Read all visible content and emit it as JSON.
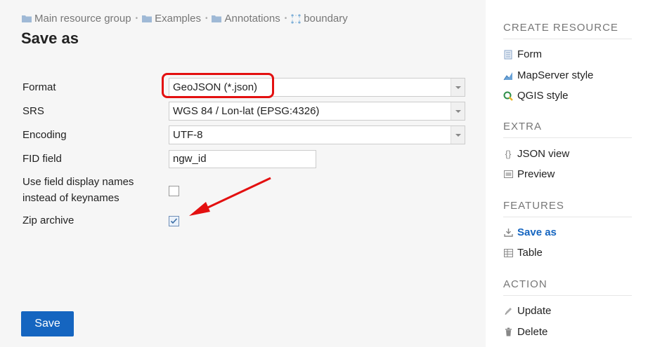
{
  "breadcrumb": {
    "items": [
      "Main resource group",
      "Examples",
      "Annotations",
      "boundary"
    ],
    "separator": "•"
  },
  "page": {
    "title": "Save as"
  },
  "form": {
    "format_label": "Format",
    "format_value": "GeoJSON (*.json)",
    "srs_label": "SRS",
    "srs_value": "WGS 84 / Lon-lat (EPSG:4326)",
    "encoding_label": "Encoding",
    "encoding_value": "UTF-8",
    "fid_label": "FID field",
    "fid_value": "ngw_id",
    "display_names_label_1": "Use field display names",
    "display_names_label_2": "instead of keynames",
    "display_names_checked": false,
    "zip_label": "Zip archive",
    "zip_checked": true,
    "save_label": "Save"
  },
  "sidebar": {
    "create_heading": "CREATE RESOURCE",
    "create_items": [
      "Form",
      "MapServer style",
      "QGIS style"
    ],
    "extra_heading": "EXTRA",
    "extra_items": [
      "JSON view",
      "Preview"
    ],
    "features_heading": "FEATURES",
    "features_items": [
      "Save as",
      "Table"
    ],
    "action_heading": "ACTION",
    "action_items": [
      "Update",
      "Delete"
    ]
  },
  "colors": {
    "accent": "#1565c0",
    "highlight": "#e31010",
    "muted": "#777777"
  }
}
